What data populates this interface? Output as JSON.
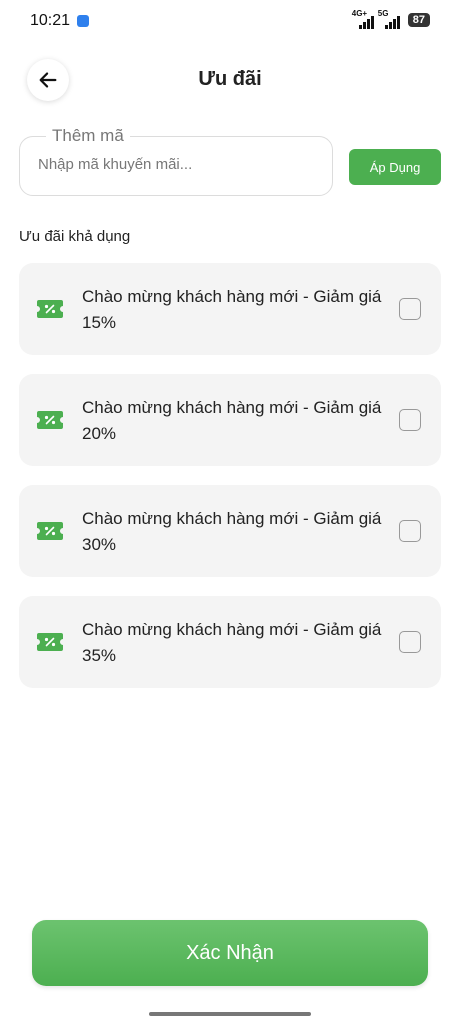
{
  "status_bar": {
    "time": "10:21",
    "network1": "4G+",
    "network2": "5G",
    "battery": "87"
  },
  "header": {
    "back_icon": "arrow-left-icon",
    "title": "Ưu đãi"
  },
  "promo_code": {
    "label": "Thêm mã",
    "placeholder": "Nhập mã khuyến mãi...",
    "value": "",
    "apply_label": "Áp Dụng"
  },
  "offers": {
    "section_title": "Ưu đãi khả dụng",
    "icon": "coupon-icon",
    "accent_color": "#4caf50",
    "items": [
      {
        "text": "Chào mừng khách hàng mới - Giảm giá 15%",
        "checked": false
      },
      {
        "text": "Chào mừng khách hàng mới - Giảm giá 20%",
        "checked": false
      },
      {
        "text": "Chào mừng khách hàng mới - Giảm giá 30%",
        "checked": false
      },
      {
        "text": "Chào mừng khách hàng mới - Giảm giá 35%",
        "checked": false
      }
    ]
  },
  "footer": {
    "confirm_label": "Xác Nhận"
  }
}
